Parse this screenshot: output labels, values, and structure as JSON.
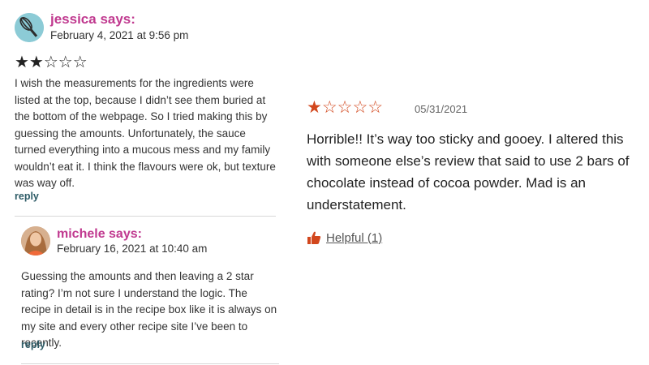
{
  "comments": [
    {
      "author": "jessica says:",
      "date": "February 4, 2021 at 9:56 pm",
      "rating_stars": "★★☆☆☆",
      "body": "I wish the measurements for the ingredients were listed at the top, because I didn’t see them buried at the bottom of the webpage. So I tried making this by guessing the amounts. Unfortunately, the sauce turned everything into a mucous mess and my family wouldn’t eat it. I think the flavours were ok, but texture was way off.",
      "reply_label": "reply"
    },
    {
      "author": "michele says:",
      "date": "February 16, 2021 at 10:40 am",
      "body": "Guessing the amounts and then leaving a 2 star rating? I’m not sure I understand the logic. The recipe in detail is in the recipe box like it is always on my site and every other recipe site I’ve been to recently.",
      "reply_label": "reply"
    }
  ],
  "review": {
    "rating_stars": "★☆☆☆☆",
    "date": "05/31/2021",
    "body": "Horrible!! It’s way too sticky and gooey. I altered this with someone else’s review that said to use 2 bars of chocolate instead of cocoa powder. Mad is an understatement.",
    "helpful_label": "Helpful (1)"
  },
  "colors": {
    "author": "#c0398f",
    "reply": "#2d5b66",
    "review_star": "#d2471d",
    "thumb": "#d2471d"
  },
  "icons": {
    "comment_avatar_1": "whisk-avatar-icon",
    "comment_avatar_2": "user-photo-avatar",
    "helpful": "thumbs-up-icon"
  }
}
